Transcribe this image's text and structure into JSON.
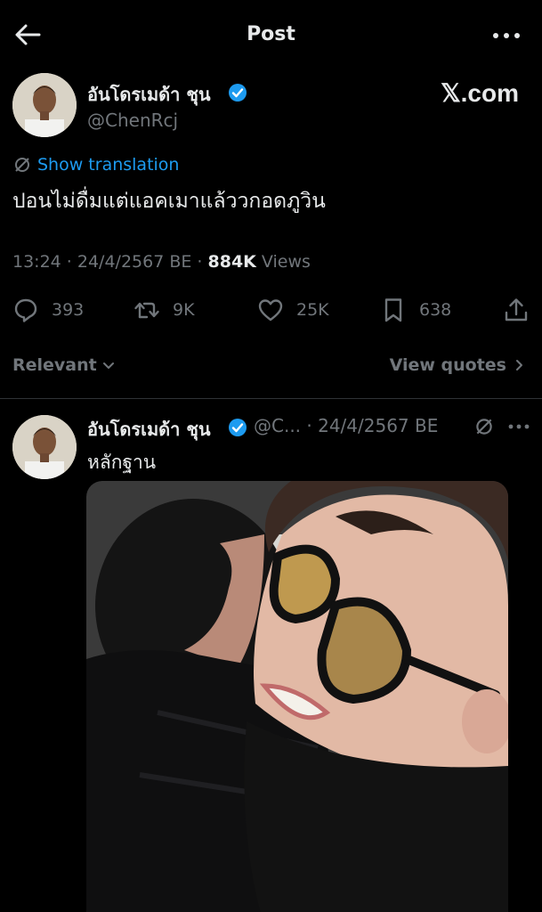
{
  "topbar": {
    "title": "Post"
  },
  "post": {
    "author_name": "อันโดรเมด้า ชุน",
    "handle": "@ChenRcj",
    "brand": "𝕏.com",
    "show_translation": "Show translation",
    "text": "ปอนไม่ดื่มแต่แอคเมาแล้ววกอดภูวิน",
    "time_date": "13:24 · 24/4/2567 BE · ",
    "views_count": "884K",
    "views_label": " Views",
    "stats": {
      "replies": "393",
      "reposts": "9K",
      "likes": "25K",
      "bookmarks": "638"
    }
  },
  "sort": {
    "label": "Relevant",
    "view_quotes": "View quotes"
  },
  "reply": {
    "author_name": "อันโดรเมด้า ชุน",
    "meta": "@C... · 24/4/2567 BE",
    "text": "หลักฐาน"
  },
  "colors": {
    "background": "#000000",
    "text": "#e7e9ea",
    "muted": "#71767b",
    "accent": "#1d9bf0",
    "divider": "#2f3336"
  }
}
